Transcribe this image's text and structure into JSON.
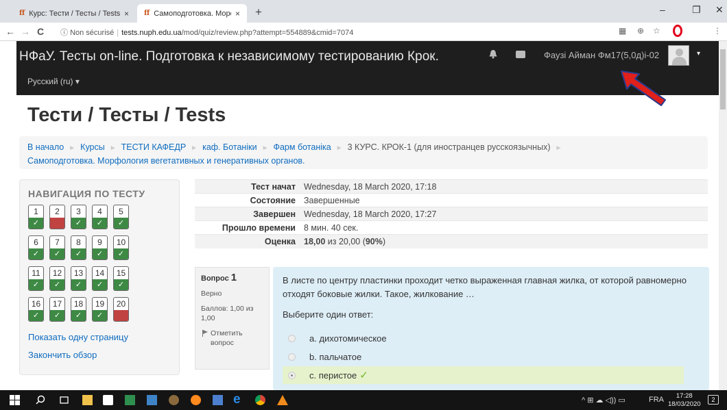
{
  "browser": {
    "tabs": [
      {
        "favicon": "ff",
        "title": "Курс: Тести / Тесты / Tests",
        "close": "×"
      },
      {
        "favicon": "ff",
        "title": "Самоподготовка. Морфология",
        "close": "×"
      }
    ],
    "new_tab": "+",
    "window_controls": {
      "minimize": "–",
      "maximize": "❐",
      "close": "✕"
    },
    "nav": {
      "back": "←",
      "forward": "→",
      "reload": "C"
    },
    "security_label": "Non sécurisé",
    "url_host": "tests.nuph.edu.ua",
    "url_path": "/mod/quiz/review.php?attempt=554889&cmid=7074"
  },
  "header": {
    "site_title": "НФаУ. Тесты on-line. Подготовка к независимому тестированию Крок.",
    "language": "Русский (ru) ▾",
    "username": "Фаузі Айман Фм17(5,0д)і-02",
    "caret": "▾",
    "icons": [
      "bell-icon",
      "chat-icon"
    ]
  },
  "page": {
    "title": "Тести / Тесты / Tests"
  },
  "breadcrumb": [
    "В начало",
    "Курсы",
    "ТЕСТИ КАФЕДР",
    "каф. Ботаніки",
    "Фарм ботаніка",
    "3 КУРС. КРОК-1 (для иностранцев русскоязычных)",
    "Самоподготовка. Морфология вегетативных и генеративных органов."
  ],
  "quiz_nav": {
    "title": "НАВИГАЦИЯ ПО ТЕСТУ",
    "buttons": [
      {
        "num": "1",
        "status": "ok"
      },
      {
        "num": "2",
        "status": "bad"
      },
      {
        "num": "3",
        "status": "ok"
      },
      {
        "num": "4",
        "status": "ok"
      },
      {
        "num": "5",
        "status": "ok"
      },
      {
        "num": "6",
        "status": "ok"
      },
      {
        "num": "7",
        "status": "ok"
      },
      {
        "num": "8",
        "status": "ok"
      },
      {
        "num": "9",
        "status": "ok"
      },
      {
        "num": "10",
        "status": "ok"
      },
      {
        "num": "11",
        "status": "ok"
      },
      {
        "num": "12",
        "status": "ok"
      },
      {
        "num": "13",
        "status": "ok"
      },
      {
        "num": "14",
        "status": "ok"
      },
      {
        "num": "15",
        "status": "ok"
      },
      {
        "num": "16",
        "status": "ok"
      },
      {
        "num": "17",
        "status": "ok"
      },
      {
        "num": "18",
        "status": "ok"
      },
      {
        "num": "19",
        "status": "ok"
      },
      {
        "num": "20",
        "status": "bad"
      }
    ],
    "tick": "✓",
    "show_one_page": "Показать одну страницу",
    "finish_review": "Закончить обзор"
  },
  "summary": {
    "rows": [
      {
        "label": "Тест начат",
        "value": "Wednesday, 18 March 2020, 17:18"
      },
      {
        "label": "Состояние",
        "value": "Завершенные"
      },
      {
        "label": "Завершен",
        "value": "Wednesday, 18 March 2020, 17:27"
      },
      {
        "label": "Прошло времени",
        "value": "8 мин. 40 сек."
      }
    ],
    "grade_label": "Оценка",
    "grade_value": "18,00",
    "grade_of": " из 20,00 (",
    "grade_percent": "90%",
    "grade_close": ")"
  },
  "question": {
    "label": "Вопрос",
    "number": "1",
    "state": "Верно",
    "mark": "Баллов: 1,00 из 1,00",
    "flag": "Отметить вопрос",
    "text": "В листе по центру пластинки проходит четко выраженная главная жилка, от которой равномерно отходят боковые жилки. Такое, жилкование …",
    "prompt": "Выберите один ответ:",
    "options": [
      {
        "text": "a. дихотомическое",
        "checked": false,
        "correct": false
      },
      {
        "text": "b. пальчатое",
        "checked": false,
        "correct": false
      },
      {
        "text": "c. перистое",
        "checked": true,
        "correct": true
      }
    ],
    "correct_mark": "✓"
  },
  "taskbar": {
    "tray_text": "^ ⊞ ☁ ◁)) ▭",
    "language": "FRA",
    "time": "17:28",
    "date": "18/03/2020",
    "notification_count": "2"
  },
  "colors": {
    "header_bg": "#1e1e1e",
    "link": "#0f6cbf",
    "status_ok": "#3e8a45",
    "status_bad": "#c04341",
    "question_bg": "#deeef7",
    "arrow": "#e0201b"
  }
}
